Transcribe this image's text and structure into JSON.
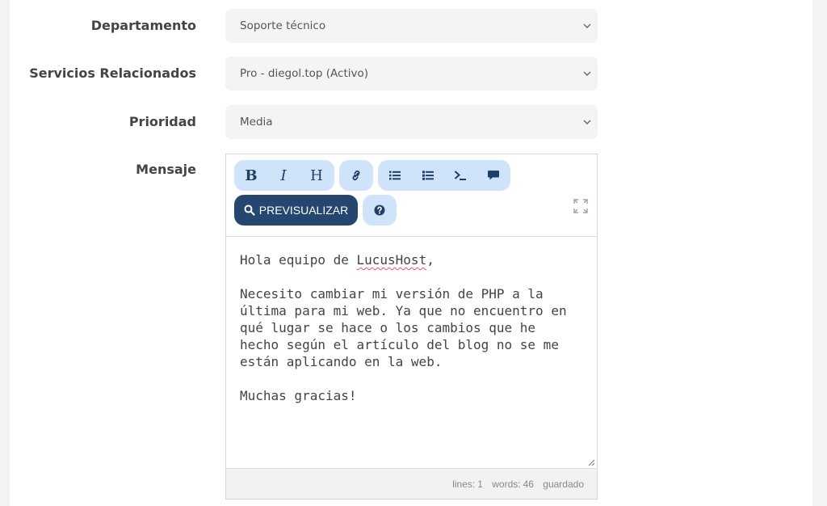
{
  "form": {
    "department": {
      "label": "Departamento",
      "value": "Soporte técnico"
    },
    "services": {
      "label": "Servicios Relacionados",
      "value": "Pro - diegol.top (Activo)"
    },
    "priority": {
      "label": "Prioridad",
      "value": "Media"
    },
    "message": {
      "label": "Mensaje"
    }
  },
  "editor": {
    "toolbar": {
      "bold": "bold-icon",
      "italic": "italic-icon",
      "heading": "heading-icon",
      "link": "link-icon",
      "unordered_list": "list-ul-icon",
      "ordered_list": "list-ol-icon",
      "code": "terminal-icon",
      "quote": "comment-icon",
      "preview_label": "PREVISUALIZAR",
      "help": "question-circle-icon",
      "fullscreen": "expand-icon"
    },
    "content": {
      "line1_prefix": "Hola equipo de ",
      "line1_word": "LucusHost",
      "line1_suffix": ",",
      "body": "Necesito cambiar mi versión de PHP a la\núltima para mi web. Ya que no encuentro en\nqué lugar se hace o los cambios que he\nhecho según el artículo del blog no se me\nestán aplicando en la web.\n\nMuchas gracias!"
    },
    "status": {
      "lines_label": "lines:",
      "lines_value": "1",
      "words_label": "words:",
      "words_value": "46",
      "saved": "guardado"
    }
  },
  "colors": {
    "toolbar_bg": "#cfe3fb",
    "toolbar_icon": "#1f3f66",
    "preview_bg": "#24466f"
  }
}
